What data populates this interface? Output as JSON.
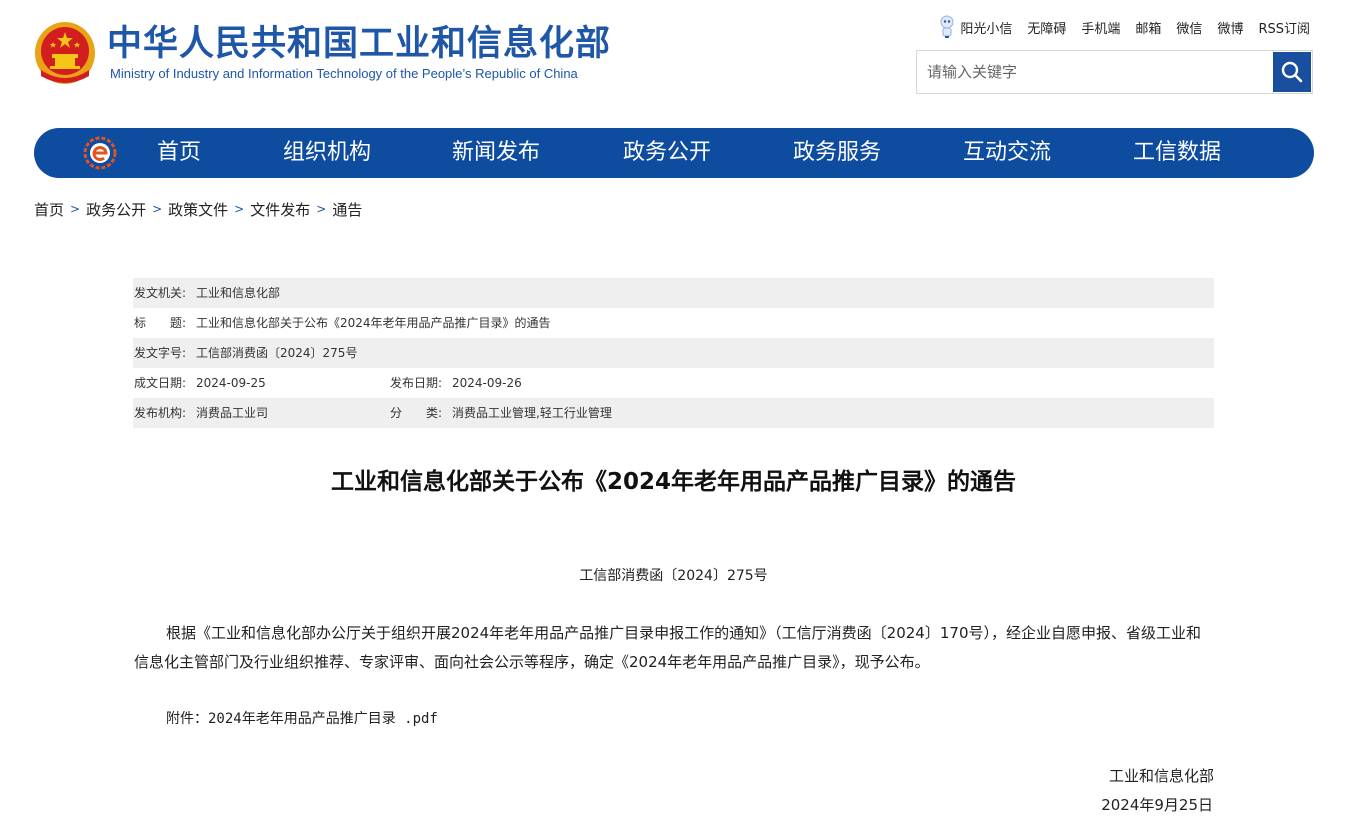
{
  "header": {
    "title_cn": "中华人民共和国工业和信息化部",
    "title_en": "Ministry of Industry and Information Technology of the People’s Republic of China"
  },
  "toplinks": [
    "阳光小信",
    "无障碍",
    "手机端",
    "邮箱",
    "微信",
    "微博",
    "RSS订阅"
  ],
  "search": {
    "placeholder": "请输入关键字"
  },
  "nav": [
    "首页",
    "组织机构",
    "新闻发布",
    "政务公开",
    "政务服务",
    "互动交流",
    "工信数据"
  ],
  "breadcrumb": [
    "首页",
    "政务公开",
    "政策文件",
    "文件发布",
    "通告"
  ],
  "meta": {
    "issuer_label": "发文机关:",
    "issuer": "工业和信息化部",
    "title_label": "标　　题:",
    "title": "工业和信息化部关于公布《2024年老年用品产品推广目录》的通告",
    "docno_label": "发文字号:",
    "docno": "工信部消费函〔2024〕275号",
    "created_label": "成文日期:",
    "created": "2024-09-25",
    "published_label": "发布日期:",
    "published": "2024-09-26",
    "org_label": "发布机构:",
    "org": "消费品工业司",
    "category_label": "分　　类:",
    "category": "消费品工业管理,轻工行业管理"
  },
  "article": {
    "title": "工业和信息化部关于公布《2024年老年用品产品推广目录》的通告",
    "doc_number": "工信部消费函〔2024〕275号",
    "body": "根据《工业和信息化部办公厅关于组织开展2024年老年用品产品推广目录申报工作的通知》（工信厅消费函〔2024〕170号），经企业自愿申报、省级工业和信息化主管部门及行业组织推荐、专家评审、面向社会公示等程序，确定《2024年老年用品产品推广目录》，现予公布。",
    "attachment_label": "附件：",
    "attachment_name": "2024年老年用品产品推广目录 .pdf",
    "sign_org": "工业和信息化部",
    "sign_date": "2024年9月25日"
  },
  "colors": {
    "brand_blue": "#0e4c9f",
    "title_blue": "#1e56a8",
    "meta_shade": "#efefef"
  }
}
